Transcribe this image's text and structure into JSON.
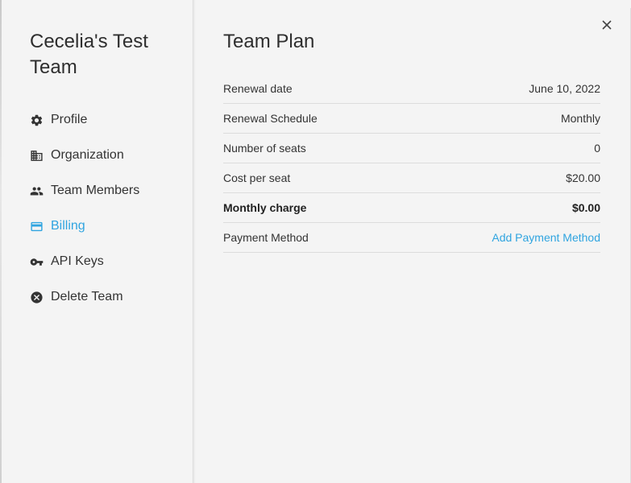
{
  "sidebar": {
    "team_name": "Cecelia's Test Team",
    "items": [
      {
        "label": "Profile",
        "icon": "gear-icon",
        "active": false
      },
      {
        "label": "Organization",
        "icon": "building-icon",
        "active": false
      },
      {
        "label": "Team Members",
        "icon": "people-icon",
        "active": false
      },
      {
        "label": "Billing",
        "icon": "credit-card-icon",
        "active": true
      },
      {
        "label": "API Keys",
        "icon": "key-icon",
        "active": false
      },
      {
        "label": "Delete Team",
        "icon": "cancel-circle-icon",
        "active": false
      }
    ]
  },
  "main": {
    "title": "Team Plan",
    "close_icon": "close-icon",
    "rows": [
      {
        "label": "Renewal date",
        "value": "June 10, 2022"
      },
      {
        "label": "Renewal Schedule",
        "value": "Monthly"
      },
      {
        "label": "Number of seats",
        "value": "0"
      },
      {
        "label": "Cost per seat",
        "value": "$20.00"
      },
      {
        "label": "Monthly charge",
        "value": "$0.00",
        "bold": true
      },
      {
        "label": "Payment Method",
        "value": "Add Payment Method",
        "link": true
      }
    ]
  },
  "colors": {
    "accent": "#2fa4e0",
    "background": "#f4f4f4",
    "divider": "#dcdcdc",
    "text": "#333333"
  }
}
